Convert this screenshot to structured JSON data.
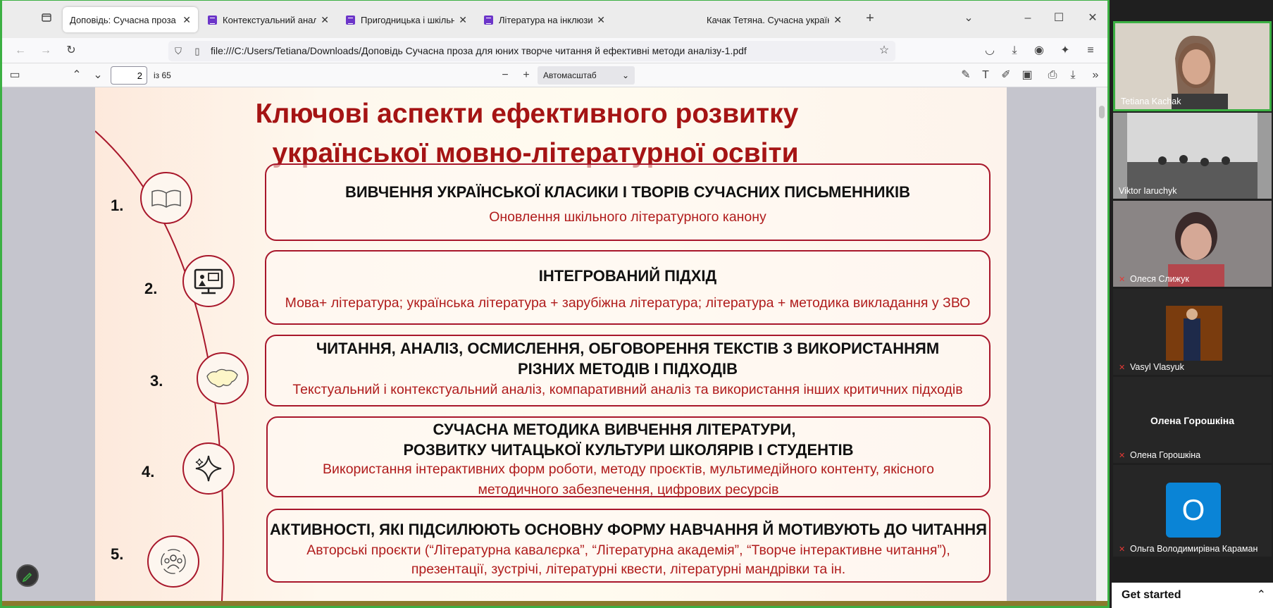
{
  "tabs": [
    {
      "title": "Доповідь: Сучасна проза для юних",
      "active": true,
      "icon": "document-icon"
    },
    {
      "title": "Контекстуальний аналіз худож",
      "active": false,
      "icon": "forms-icon"
    },
    {
      "title": "Пригодницька і шкільна проза",
      "active": false,
      "icon": "forms-icon"
    },
    {
      "title": "Література на інклюзивну тем",
      "active": false,
      "icon": "forms-icon"
    },
    {
      "title": "Качак Тетяна. Сучасна українська",
      "active": false,
      "icon": "none"
    }
  ],
  "new_tab_label": "+",
  "url": "file:///C:/Users/Tetiana/Downloads/Доповідь Сучасна проза для юних творче читання й ефективні методи аналізу-1.pdf",
  "pdf": {
    "page_current": "2",
    "page_total": "із 65",
    "zoom": "Автомасштаб"
  },
  "slide": {
    "title_line1": "Ключові аспекти ефективного розвитку",
    "title_line2": "української  мовно-літературної освіти",
    "items": [
      {
        "num": "1.",
        "heading": "ВИВЧЕННЯ УКРАЇНСЬКОЇ КЛАСИКИ І  ТВОРІВ СУЧАСНИХ ПИСЬМЕННИКІВ",
        "heading2": "",
        "sub": "Оновлення шкільного літературного канону",
        "sub2": "",
        "icon": "open-book-icon"
      },
      {
        "num": "2.",
        "heading": "ІНТЕГРОВАНИЙ ПІДХІД",
        "heading2": "",
        "sub": "Мова+ література; українська література + зарубіжна література; література + методика викладання у ЗВО",
        "sub2": "",
        "icon": "presentation-monitor-icon"
      },
      {
        "num": "3.",
        "heading": "ЧИТАННЯ, АНАЛІЗ, ОСМИСЛЕННЯ, ОБГОВОРЕННЯ ТЕКСТІВ З ВИКОРИСТАННЯМ",
        "heading2": "РІЗНИХ МЕТОДІВ І ПІДХОДІВ",
        "sub": "Текстуальний і контекстуальний аналіз, компаративний аналіз та використання інших критичних підходів",
        "sub2": "",
        "icon": "ukraine-map-icon"
      },
      {
        "num": "4.",
        "heading": "СУЧАСНА МЕТОДИКА ВИВЧЕННЯ ЛІТЕРАТУРИ,",
        "heading2": "РОЗВИТКУ ЧИТАЦЬКОЇ КУЛЬТУРИ ШКОЛЯРІВ І СТУДЕНТІВ",
        "sub": "Використання інтерактивних форм роботи, методу проєктів, мультимедійного контенту, якісного",
        "sub2": "методичного забезпечення, цифрових ресурсів",
        "icon": "sparkle-icon"
      },
      {
        "num": "5.",
        "heading": "АКТИВНОСТІ, ЯКІ ПІДСИЛЮЮТЬ ОСНОВНУ ФОРМУ НАВЧАННЯ Й МОТИВУЮТЬ ДО ЧИТАННЯ",
        "heading2": "",
        "sub": "Авторські проєкти (“Літературна кавалєрка”, “Літературна академія”, “Творче інтерактивне читання”),",
        "sub2": "презентації, зустрічі, літературні квести, літературні мандрівки та ін.",
        "icon": "group-people-icon"
      }
    ]
  },
  "participants": [
    {
      "name": "Tetiana Kachak",
      "muted": false,
      "type": "video"
    },
    {
      "name": "Viktor Iaruchyk",
      "muted": false,
      "type": "video"
    },
    {
      "name": "Олеся Слижук",
      "muted": true,
      "type": "video"
    },
    {
      "name": "Vasyl Vlasyuk",
      "muted": true,
      "type": "photo"
    },
    {
      "name": "Олена Горошкіна",
      "muted": true,
      "type": "name",
      "display": "Олена Горошкіна"
    },
    {
      "name": "Ольга Володимирівна Караман",
      "muted": true,
      "type": "avatar",
      "initial": "О"
    }
  ],
  "get_started": "Get started",
  "colors": {
    "accent_red": "#a51414",
    "card_border": "#a8172b",
    "active_speaker": "#3cb043",
    "avatar_blue": "#0a84d6"
  }
}
